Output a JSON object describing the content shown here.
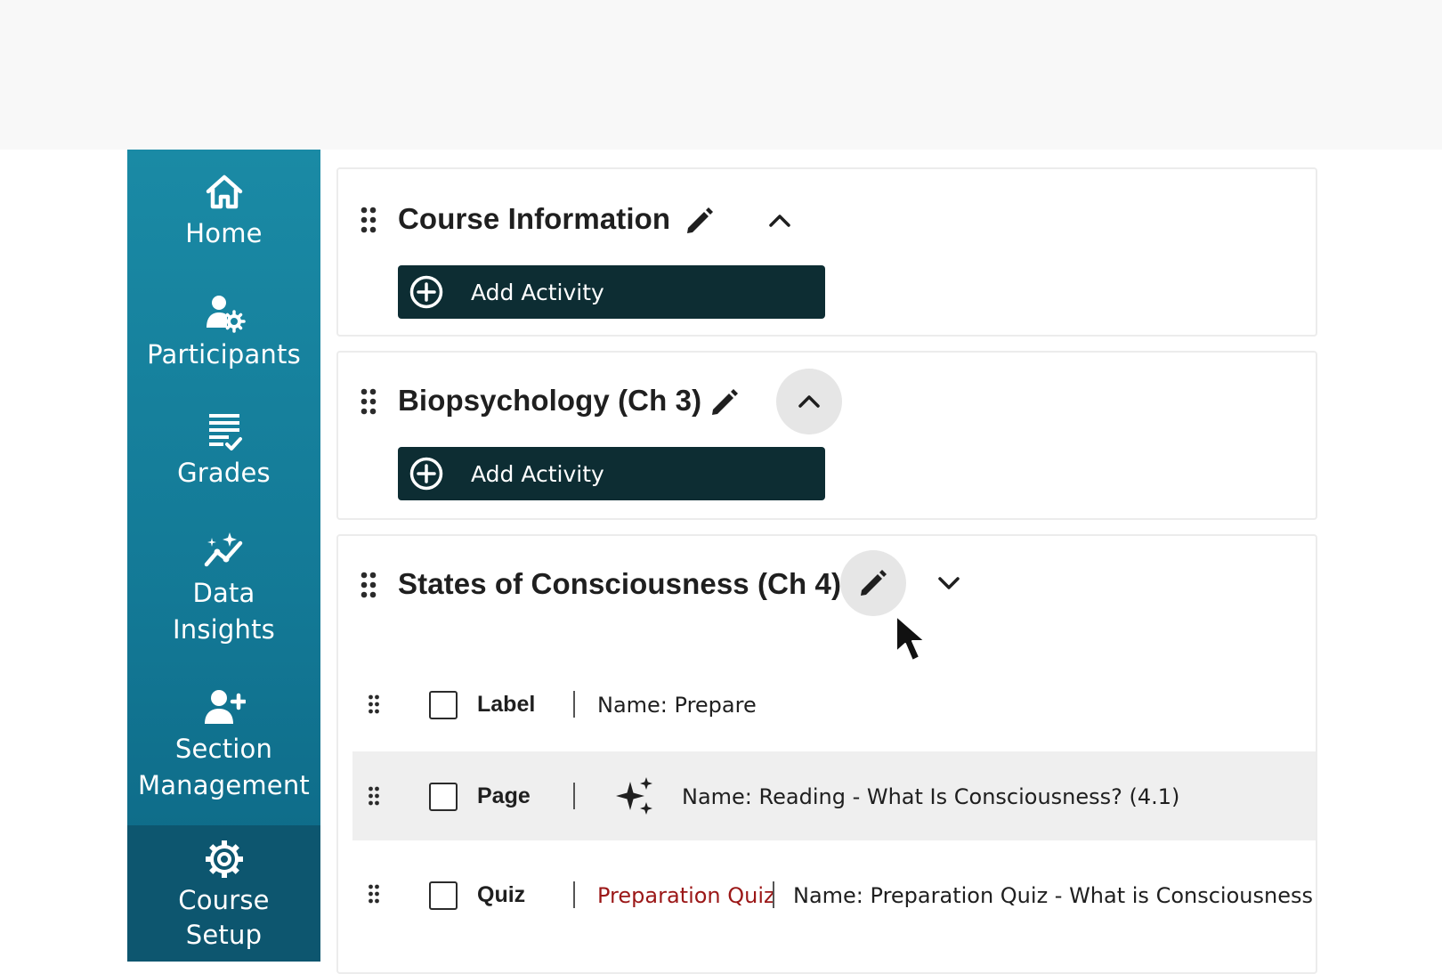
{
  "sidebar": {
    "items": [
      {
        "label": "Home",
        "icon": "home-icon"
      },
      {
        "label": "Participants",
        "icon": "participants-icon"
      },
      {
        "label": "Grades",
        "icon": "grades-icon"
      },
      {
        "label_lines": [
          "Data",
          "Insights"
        ],
        "icon": "data-insights-icon"
      },
      {
        "label_lines": [
          "Section",
          "Management"
        ],
        "icon": "section-management-icon"
      },
      {
        "label_lines": [
          "Course",
          "Setup"
        ],
        "icon": "gear-icon",
        "active": true
      }
    ]
  },
  "sections": [
    {
      "title": "Course Information",
      "add_label": "Add Activity",
      "expanded": true
    },
    {
      "title": "Biopsychology (Ch 3)",
      "add_label": "Add Activity",
      "expanded": true
    },
    {
      "title": "States of Consciousness (Ch 4)",
      "expanded": false,
      "activities": [
        {
          "type": "Label",
          "name": "Name: Prepare"
        },
        {
          "type": "Page",
          "name": "Name: Reading - What Is Consciousness? (4.1)",
          "icon": "sparkle-icon",
          "highlighted": true
        },
        {
          "type": "Quiz",
          "tag": "Preparation Quiz",
          "name": "Name: Preparation Quiz - What is Consciousness"
        }
      ]
    }
  ],
  "colors": {
    "sidebar": "#137996",
    "sidebar_active": "#0d566f",
    "button": "#0d2d33",
    "quiz_tag": "#9b1717"
  }
}
